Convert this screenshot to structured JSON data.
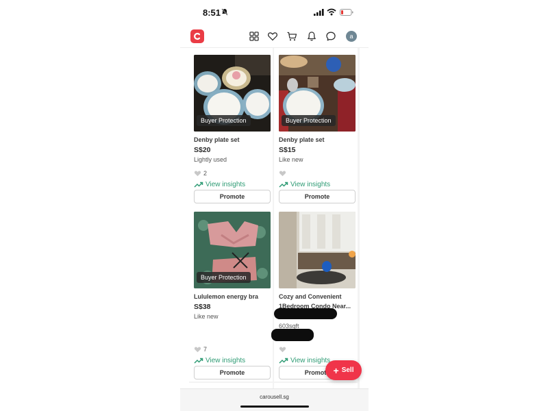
{
  "status_bar": {
    "time": "8:51"
  },
  "header": {
    "avatar_letter": "a"
  },
  "listings": [
    {
      "title": "Denby plate set",
      "price": "S$20",
      "condition": "Lightly used",
      "likes": "2",
      "badge": "Buyer Protection",
      "insights": "View insights",
      "promote": "Promote"
    },
    {
      "title": "Denby plate set",
      "price": "S$15",
      "condition": "Like new",
      "likes": "",
      "badge": "Buyer Protection",
      "insights": "View insights",
      "promote": "Promote"
    },
    {
      "title": "Lululemon energy bra",
      "price": "S$38",
      "condition": "Like new",
      "likes": "7",
      "badge": "Buyer Protection",
      "insights": "View insights",
      "promote": "Promote"
    },
    {
      "title": "Cozy and Convenient",
      "title_line2": "1Bedroom Condo Near...",
      "detail": "603sqft",
      "likes": "",
      "insights": "View insights",
      "promote": "Promote"
    }
  ],
  "sell_button": {
    "label": "Sell"
  },
  "browser": {
    "url": "carousell.sg"
  },
  "colors": {
    "brand": "#ea3c45",
    "sell": "#f0344a",
    "insights": "#2e9b74"
  }
}
